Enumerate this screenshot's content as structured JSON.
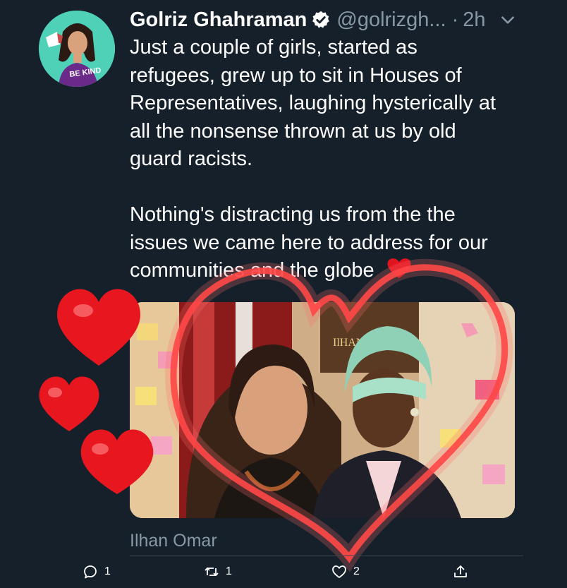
{
  "tweet": {
    "author_name": "Golriz Ghahraman",
    "handle": "@golrizgh...",
    "separator": "·",
    "time": "2h",
    "text": "Just a couple of girls, started as\nrefugees, grew up to sit in Houses of\nRepresentatives, laughing hysterically at\nall the nonsense thrown at us by old\nguard racists.\n\nNothing's distracting us from the the\nissues we came here to address for our\ncommunities and the globe",
    "avatar_shirt_text": "BE KIND",
    "photo_sign_text": "IlHAN",
    "tagged_person": "Ilhan Omar"
  },
  "actions": {
    "reply_count": "1",
    "retweet_count": "1",
    "like_count": "2"
  },
  "icons": [
    "verified-badge-icon",
    "chevron-down-icon",
    "heart-emoji-icon",
    "person-icon",
    "reply-icon",
    "retweet-icon",
    "like-icon",
    "share-icon"
  ],
  "colors": {
    "background": "#15202b",
    "secondary_text": "#8899a6",
    "heart_red": "#e0151f",
    "avatar_teal": "#4fd1b8"
  }
}
